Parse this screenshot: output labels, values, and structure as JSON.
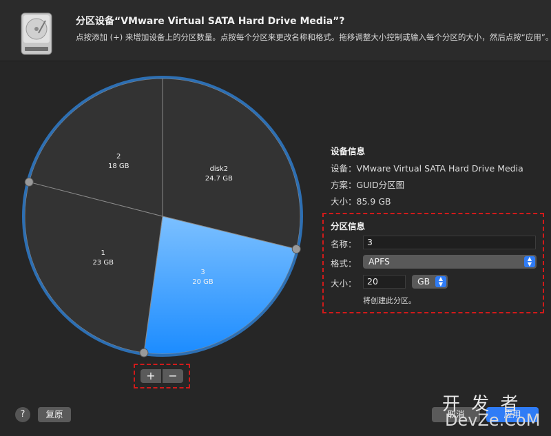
{
  "header": {
    "title": "分区设备“VMware Virtual SATA Hard Drive Media”?",
    "description": "点按添加 (+) 来增加设备上的分区数量。点按每个分区来更改名称和格式。拖移调整大小控制或输入每个分区的大小，然后点按“应用”。",
    "icon": "hard-drive-icon"
  },
  "chart_data": {
    "type": "pie",
    "slices": [
      {
        "name": "disk2",
        "size_label": "24.7 GB",
        "value": 24.7,
        "color": "#333333"
      },
      {
        "name": "3",
        "size_label": "20 GB",
        "value": 20,
        "color": "#46a4ff",
        "selected": true
      },
      {
        "name": "1",
        "size_label": "23 GB",
        "value": 23,
        "color": "#333333"
      },
      {
        "name": "2",
        "size_label": "18 GB",
        "value": 18,
        "color": "#333333"
      }
    ],
    "total": 85.9,
    "start": "12 o'clock",
    "direction": "clockwise"
  },
  "partition_controls": {
    "add_label": "+",
    "remove_label": "−"
  },
  "device_info": {
    "title": "设备信息",
    "device_label": "设备：",
    "device_value": "VMware Virtual SATA Hard Drive Media",
    "scheme_label": "方案：",
    "scheme_value": "GUID分区图",
    "size_label": "大小：",
    "size_value": "85.9 GB"
  },
  "partition_info": {
    "title": "分区信息",
    "name_label": "名称：",
    "name_value": "3",
    "format_label": "格式：",
    "format_value": "APFS",
    "size_label": "大小：",
    "size_value": "20",
    "unit_value": "GB",
    "note": "将创建此分区。"
  },
  "footer": {
    "help_label": "?",
    "revert_label": "复原",
    "cancel_label": "取消",
    "apply_label": "应用"
  },
  "watermark": {
    "line1": "开 发 者",
    "line2": "DevZe.CoM"
  },
  "colors": {
    "accent": "#2f7cf6",
    "selected_slice": "#46a4ff",
    "highlight_border": "#d11a1a"
  }
}
